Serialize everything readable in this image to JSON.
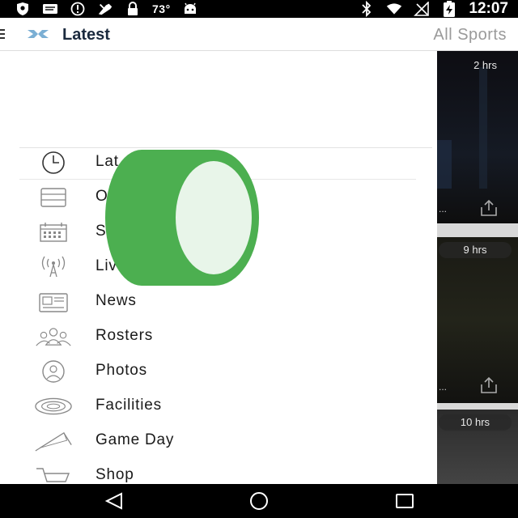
{
  "status_bar": {
    "temperature": "73°",
    "time": "12:07",
    "left_icons": [
      "shield-icon",
      "message-icon",
      "alert-circle-icon",
      "sports-icon",
      "lock-icon",
      "android-icon"
    ],
    "right_icons": [
      "bluetooth-icon",
      "wifi-icon",
      "no-signal-icon",
      "battery-charging-icon"
    ]
  },
  "app_bar": {
    "title": "Latest",
    "all_sports": "All Sports",
    "brand_color": "#7bafd4",
    "title_color": "#1b2a3e"
  },
  "feed": {
    "cards": [
      {
        "time": "2 hrs",
        "more": "..."
      },
      {
        "time": "9 hrs",
        "more": "..."
      },
      {
        "time": "10 hrs"
      }
    ]
  },
  "drawer": {
    "items": [
      {
        "label": "Lat",
        "icon": "clock-icon"
      },
      {
        "label": "O",
        "icon": "stack-icon"
      },
      {
        "label": "S",
        "icon": "calendar-icon"
      },
      {
        "label": "Liv",
        "icon": "broadcast-icon"
      },
      {
        "label": "News",
        "icon": "newspaper-icon"
      },
      {
        "label": "Rosters",
        "icon": "people-icon"
      },
      {
        "label": "Photos",
        "icon": "camera-icon"
      },
      {
        "label": "Facilities",
        "icon": "stadium-icon"
      },
      {
        "label": "Game Day",
        "icon": "pennant-icon"
      },
      {
        "label": "Shop",
        "icon": "cart-icon"
      }
    ]
  },
  "overlay": {
    "outer_color": "#4caf50",
    "inner_color": "#e8f5e9"
  },
  "nav_bar": {
    "buttons": [
      "back-icon",
      "home-icon",
      "recents-icon"
    ]
  }
}
